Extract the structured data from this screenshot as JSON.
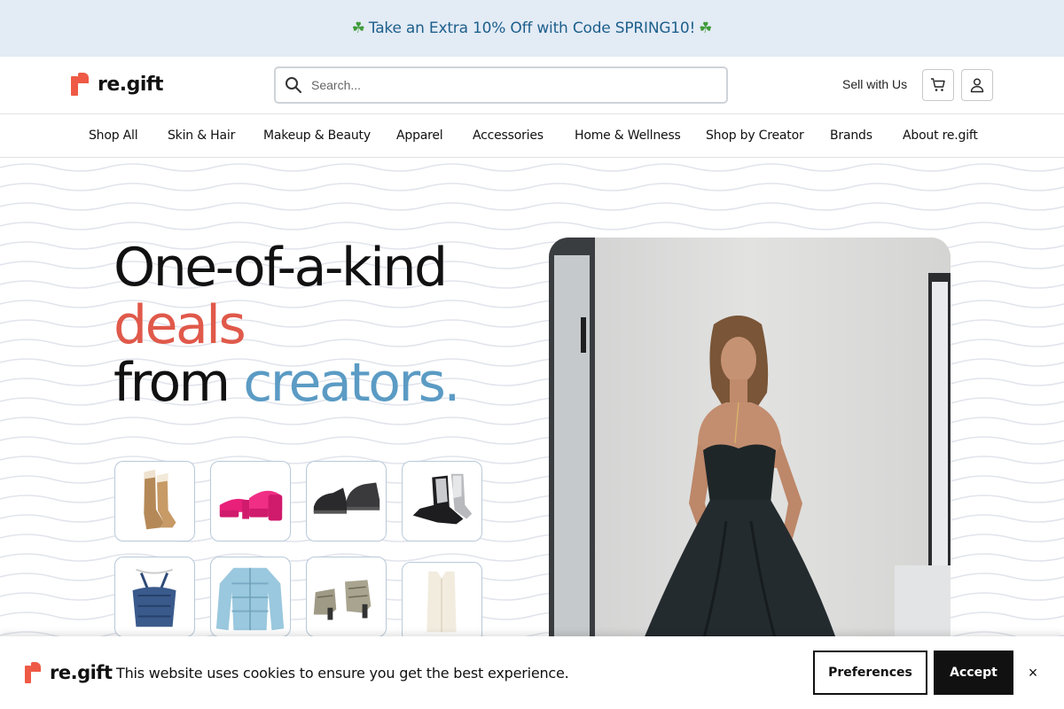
{
  "promo": {
    "text": "Take an Extra 10% Off with Code SPRING10!"
  },
  "brand": {
    "name": "re.gift"
  },
  "search": {
    "placeholder": "Search..."
  },
  "header": {
    "sell_label": "Sell with Us"
  },
  "nav": {
    "items": [
      {
        "label": "Shop All"
      },
      {
        "label": "Skin & Hair"
      },
      {
        "label": "Makeup & Beauty"
      },
      {
        "label": "Apparel"
      },
      {
        "label": "Accessories"
      },
      {
        "label": "Home & Wellness"
      },
      {
        "label": "Shop by Creator"
      },
      {
        "label": "Brands"
      },
      {
        "label": "About re.gift"
      }
    ]
  },
  "hero": {
    "line1": "One-of-a-kind",
    "line2": "deals",
    "line3a": "from ",
    "line3b": "creators."
  },
  "cookie": {
    "text": "This website uses cookies to ensure you get the best experience.",
    "preferences_label": "Preferences",
    "accept_label": "Accept",
    "close_label": "×"
  },
  "colors": {
    "accent_red": "#ee5a45",
    "accent_blue": "#5b9bc4",
    "promo_bg": "#e3ebf5",
    "promo_text": "#1d5f8c"
  }
}
